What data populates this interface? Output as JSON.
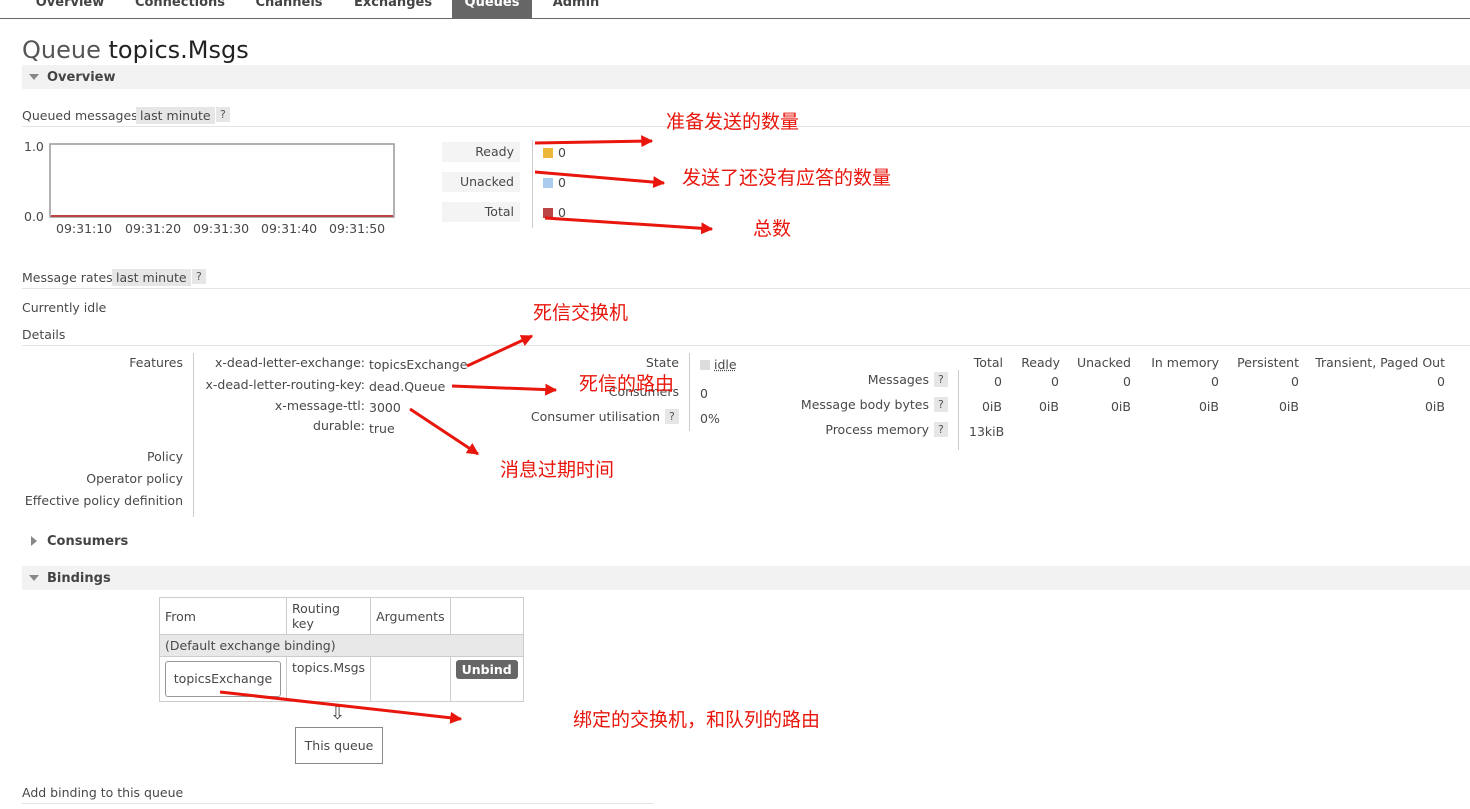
{
  "nav": {
    "tabs": [
      "Overview",
      "Connections",
      "Channels",
      "Exchanges",
      "Queues",
      "Admin"
    ],
    "active": "Queues"
  },
  "page": {
    "prefix": "Queue",
    "name": "topics.Msgs"
  },
  "overview": {
    "heading": "Overview",
    "queued_label": "Queued messages",
    "range": "last minute",
    "help": "?",
    "chart": {
      "y_top": "1.0",
      "y_bottom": "0.0",
      "x_ticks": [
        "09:31:10",
        "09:31:20",
        "09:31:30",
        "09:31:40",
        "09:31:50"
      ]
    },
    "legend": [
      {
        "label": "Ready",
        "value": "0",
        "color": "#edb73a"
      },
      {
        "label": "Unacked",
        "value": "0",
        "color": "#aaccee"
      },
      {
        "label": "Total",
        "value": "0",
        "color": "#bb4444"
      }
    ],
    "rates_label": "Message rates",
    "idle": "Currently idle",
    "details": "Details"
  },
  "chart_data": {
    "type": "line",
    "x": [
      "09:31:10",
      "09:31:20",
      "09:31:30",
      "09:31:40",
      "09:31:50"
    ],
    "series": [
      {
        "name": "Ready",
        "values": [
          0,
          0,
          0,
          0,
          0
        ]
      },
      {
        "name": "Unacked",
        "values": [
          0,
          0,
          0,
          0,
          0
        ]
      },
      {
        "name": "Total",
        "values": [
          0,
          0,
          0,
          0,
          0
        ]
      }
    ],
    "ylim": [
      0,
      1.0
    ]
  },
  "features": {
    "label": "Features",
    "args": [
      {
        "key": "x-dead-letter-exchange:",
        "value": "topicsExchange"
      },
      {
        "key": "x-dead-letter-routing-key:",
        "value": "dead.Queue"
      },
      {
        "key": "x-message-ttl:",
        "value": "3000"
      },
      {
        "key": "durable:",
        "value": "true"
      }
    ],
    "policy": "Policy",
    "operator_policy": "Operator policy",
    "effective": "Effective policy definition"
  },
  "state": {
    "state_label": "State",
    "state_value": "idle",
    "consumers_label": "Consumers",
    "consumers_value": "0",
    "util_label": "Consumer utilisation",
    "util_value": "0%"
  },
  "stats": {
    "headers": [
      "Total",
      "Ready",
      "Unacked",
      "In memory",
      "Persistent",
      "Transient, Paged Out"
    ],
    "rows": [
      {
        "label": "Messages",
        "values": [
          "0",
          "0",
          "0",
          "0",
          "0",
          "0"
        ]
      },
      {
        "label": "Message body bytes",
        "values": [
          "0iB",
          "0iB",
          "0iB",
          "0iB",
          "0iB",
          "0iB"
        ]
      },
      {
        "label": "Process memory",
        "values": [
          "13kiB"
        ]
      }
    ]
  },
  "consumers_heading": "Consumers",
  "bindings": {
    "heading": "Bindings",
    "headers": [
      "From",
      "Routing key",
      "Arguments"
    ],
    "default_row": "(Default exchange binding)",
    "row": {
      "from": "topicsExchange",
      "routing_key": "topics.Msgs",
      "arguments": "",
      "action": "Unbind"
    },
    "arrow": "⇩",
    "this_queue": "This queue",
    "add_label": "Add binding to this queue"
  },
  "annotations": {
    "ready": "准备发送的数量",
    "unacked": "发送了还没有应答的数量",
    "total": "总数",
    "dlx": "死信交换机",
    "dlrk": "死信的路由",
    "ttl": "消息过期时间",
    "binding": "绑定的交换机，和队列的路由"
  }
}
